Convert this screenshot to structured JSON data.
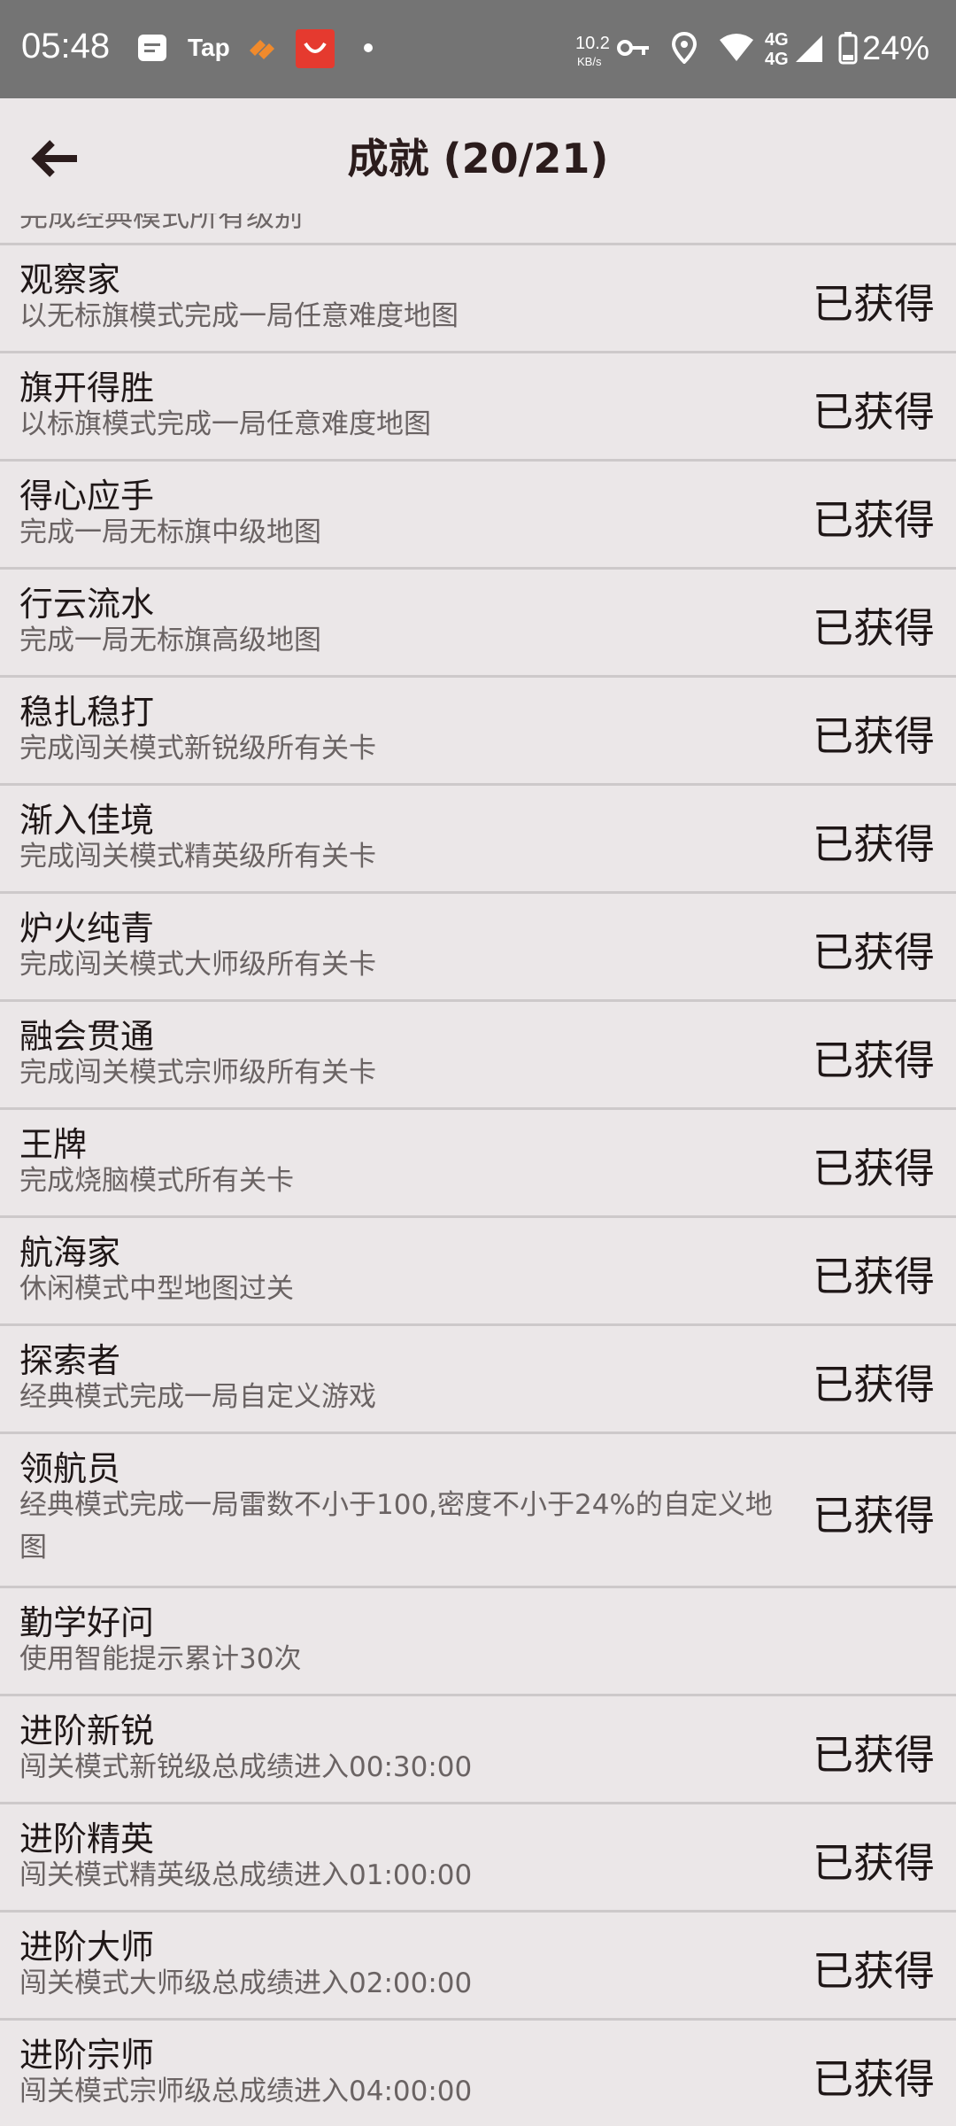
{
  "status_bar": {
    "time": "05:48",
    "tap_label": "Tap",
    "net_speed_value": "10.2",
    "net_speed_unit": "KB/s",
    "signal_label_1": "4G",
    "signal_label_2": "4G",
    "battery": "24%"
  },
  "header": {
    "title": "成就 (20/21)"
  },
  "partial_row": {
    "desc": "完成经典模式所有级别"
  },
  "achievements": [
    {
      "title": "观察家",
      "desc": "以无标旗模式完成一局任意难度地图",
      "status": "已获得"
    },
    {
      "title": "旗开得胜",
      "desc": "以标旗模式完成一局任意难度地图",
      "status": "已获得"
    },
    {
      "title": "得心应手",
      "desc": "完成一局无标旗中级地图",
      "status": "已获得"
    },
    {
      "title": "行云流水",
      "desc": "完成一局无标旗高级地图",
      "status": "已获得"
    },
    {
      "title": "稳扎稳打",
      "desc": "完成闯关模式新锐级所有关卡",
      "status": "已获得"
    },
    {
      "title": "渐入佳境",
      "desc": "完成闯关模式精英级所有关卡",
      "status": "已获得"
    },
    {
      "title": "炉火纯青",
      "desc": "完成闯关模式大师级所有关卡",
      "status": "已获得"
    },
    {
      "title": "融会贯通",
      "desc": "完成闯关模式宗师级所有关卡",
      "status": "已获得"
    },
    {
      "title": "王牌",
      "desc": "完成烧脑模式所有关卡",
      "status": "已获得"
    },
    {
      "title": "航海家",
      "desc": "休闲模式中型地图过关",
      "status": "已获得"
    },
    {
      "title": "探索者",
      "desc": "经典模式完成一局自定义游戏",
      "status": "已获得"
    },
    {
      "title": "领航员",
      "desc": "经典模式完成一局雷数不小于100,密度不小于24%的自定义地图",
      "status": "已获得"
    },
    {
      "title": "勤学好问",
      "desc": "使用智能提示累计30次",
      "status": ""
    },
    {
      "title": "进阶新锐",
      "desc": "闯关模式新锐级总成绩进入00:30:00",
      "status": "已获得"
    },
    {
      "title": "进阶精英",
      "desc": "闯关模式精英级总成绩进入01:00:00",
      "status": "已获得"
    },
    {
      "title": "进阶大师",
      "desc": "闯关模式大师级总成绩进入02:00:00",
      "status": "已获得"
    },
    {
      "title": "进阶宗师",
      "desc": "闯关模式宗师级总成绩进入04:00:00",
      "status": "已获得"
    }
  ]
}
